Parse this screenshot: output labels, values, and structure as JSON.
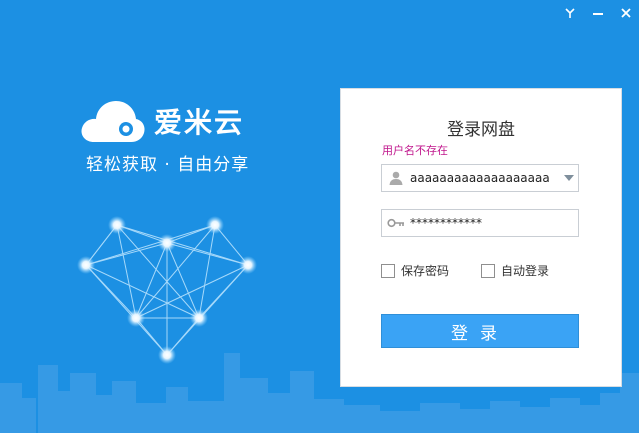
{
  "window": {
    "controls": {
      "pin_icon": "pin-icon",
      "minimize_icon": "minimize-icon",
      "close_icon": "close-icon"
    }
  },
  "brand": {
    "name": "爱米云",
    "slogan": "轻松获取 · 自由分享",
    "logo_icon": "cloud-logo-icon"
  },
  "login": {
    "title": "登录网盘",
    "error": "用户名不存在",
    "username_value": "aaaaaaaaaaaaaaaaaaa",
    "password_value": "************",
    "remember_label": "保存密码",
    "autologin_label": "自动登录",
    "submit_label": "登录"
  },
  "colors": {
    "background": "#1c90e3",
    "button": "#3aa3f5",
    "error": "#c0168c"
  }
}
